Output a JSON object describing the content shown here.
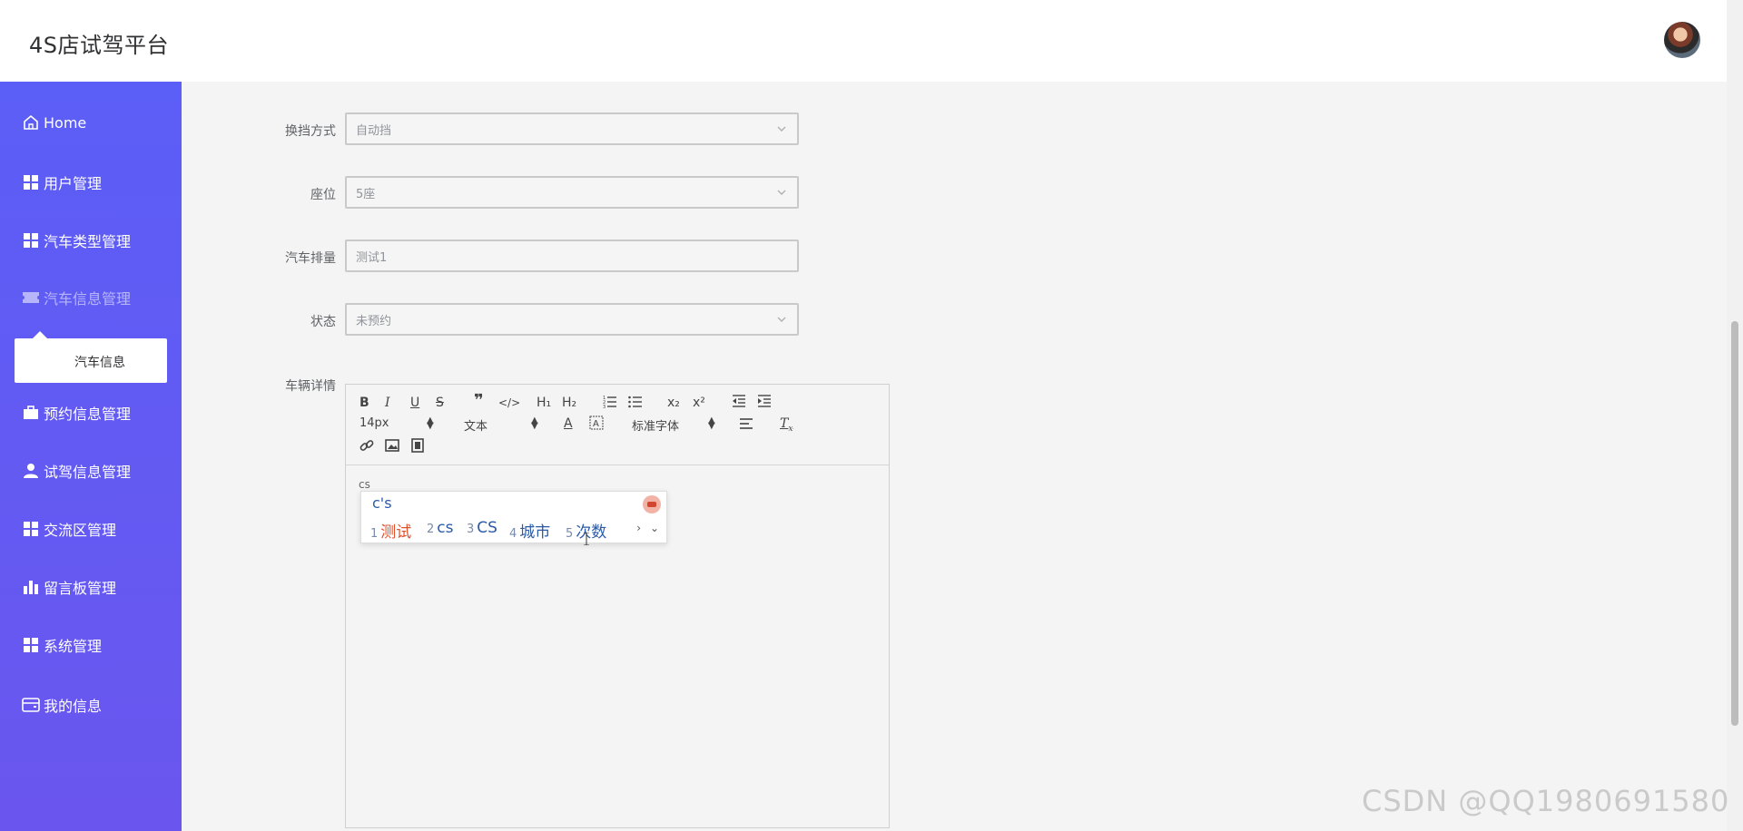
{
  "header": {
    "title": "4S店试驾平台"
  },
  "sidebar": {
    "items": [
      {
        "label": "Home",
        "icon": "home-icon"
      },
      {
        "label": "用户管理",
        "icon": "grid-icon"
      },
      {
        "label": "汽车类型管理",
        "icon": "grid-icon"
      },
      {
        "label": "汽车信息管理",
        "icon": "ticket-icon"
      },
      {
        "label": "预约信息管理",
        "icon": "briefcase-icon"
      },
      {
        "label": "试驾信息管理",
        "icon": "user-icon"
      },
      {
        "label": "交流区管理",
        "icon": "grid-icon"
      },
      {
        "label": "留言板管理",
        "icon": "bar-chart-icon"
      },
      {
        "label": "系统管理",
        "icon": "grid-icon"
      },
      {
        "label": "我的信息",
        "icon": "wallet-icon"
      }
    ],
    "submenu": {
      "label": "汽车信息"
    }
  },
  "form": {
    "gear": {
      "label": "换挡方式",
      "value": "自动挡"
    },
    "seats": {
      "label": "座位",
      "value": "5座"
    },
    "displacement": {
      "label": "汽车排量",
      "value": "测试1"
    },
    "status": {
      "label": "状态",
      "value": "未预约"
    },
    "details": {
      "label": "车辆详情"
    }
  },
  "editor": {
    "font_size": "14px",
    "header_select": "文本",
    "font_family": "标准字体",
    "content": "cs",
    "toolbar_labels": {
      "bold": "B",
      "italic": "I",
      "underline": "U",
      "strike": "S",
      "h1": "H₁",
      "h2": "H₂",
      "sub": "x₂",
      "sup": "x²",
      "clean": "T"
    }
  },
  "ime": {
    "composition": "c's",
    "candidates": [
      {
        "num": "1",
        "text": "测试"
      },
      {
        "num": "2",
        "text": "cs"
      },
      {
        "num": "3",
        "text": "CS"
      },
      {
        "num": "4",
        "text": "城市"
      },
      {
        "num": "5",
        "text": "次数"
      }
    ]
  },
  "watermark": "CSDN @QQ1980691580",
  "colors": {
    "sidebar_top": "#5b5ef7",
    "sidebar_bottom": "#6a56ee",
    "ime_first": "#e0512e",
    "ime_text": "#2a5aa8"
  }
}
